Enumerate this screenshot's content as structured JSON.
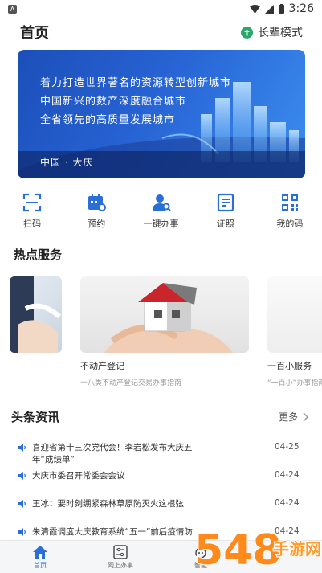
{
  "status": {
    "app_badge": "A",
    "time": "3:26"
  },
  "header": {
    "title": "首页",
    "elder_mode": "长辈模式"
  },
  "banner": {
    "lines": [
      "着力打造世界著名的资源转型创新城市",
      "中国新兴的数产深度融合城市",
      "全省领先的高质量发展城市"
    ],
    "place": "中国 · 大庆"
  },
  "quick_actions": [
    {
      "label": "扫码",
      "icon": "scan-icon"
    },
    {
      "label": "预约",
      "icon": "calendar-icon"
    },
    {
      "label": "一键办事",
      "icon": "user-search-icon"
    },
    {
      "label": "证照",
      "icon": "license-icon"
    },
    {
      "label": "我的码",
      "icon": "qrcode-icon"
    }
  ],
  "hot_services": {
    "title": "热点服务",
    "cards": [
      {
        "name": "不动产登记",
        "desc": "十八类不动产登记交易办事指南"
      },
      {
        "name": "一百小服务",
        "desc": "“一百小”办事指南"
      }
    ]
  },
  "news": {
    "title": "头条资讯",
    "more": "更多",
    "items": [
      {
        "text": "喜迎省第十三次党代会！李岩松发布大庆五年“成绩单”",
        "date": "04-25"
      },
      {
        "text": "大庆市委召开常委会会议",
        "date": "04-24"
      },
      {
        "text": "王冰：要时刻绷紧森林草原防灭火这根弦",
        "date": "04-24"
      },
      {
        "text": "朱清霞调度大庆教育系统“五一”前后疫情防",
        "date": "04-24"
      }
    ]
  },
  "tabbar": [
    {
      "label": "首页",
      "icon": "home-icon",
      "active": true
    },
    {
      "label": "网上办事",
      "icon": "sliders-icon",
      "active": false
    },
    {
      "label": "智能",
      "icon": "robot-icon",
      "active": false
    }
  ],
  "watermark": {
    "number": "548",
    "text": "手游网"
  },
  "colors": {
    "accent": "#2a6fd6",
    "elder_badge": "#2aa86a",
    "banner": "#2763d4"
  }
}
